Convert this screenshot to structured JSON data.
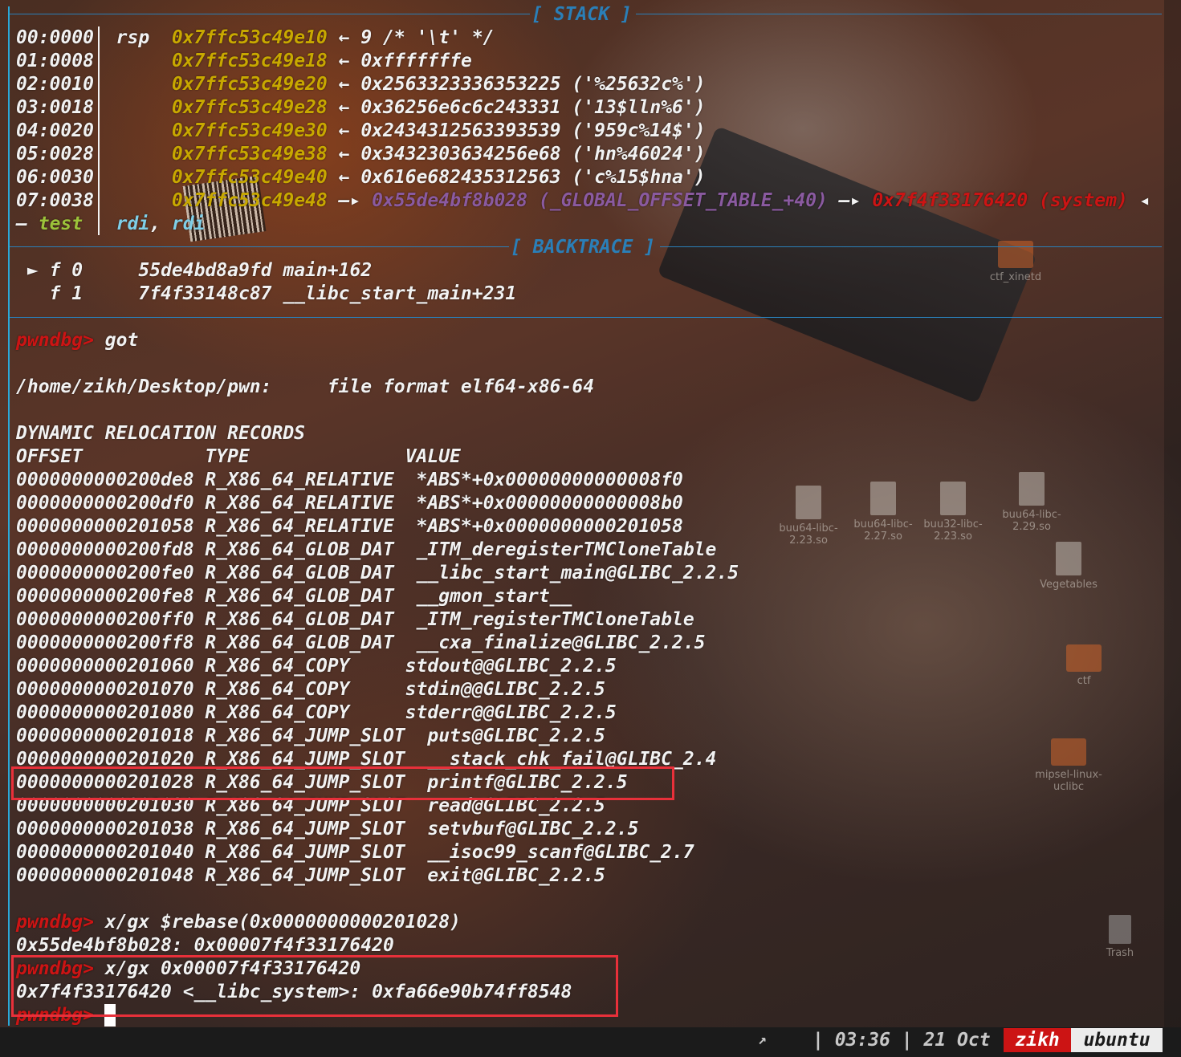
{
  "colors": {
    "address": "#c8a800",
    "got": "#8a5aa0",
    "libc": "#cc1414",
    "prompt": "#cc1414",
    "separator": "#2a7fb8",
    "highlight": "#e8303a"
  },
  "sections": {
    "stack": "[ STACK ]",
    "backtrace": "[ BACKTRACE ]"
  },
  "stack": [
    {
      "idx": "00:0000",
      "reg": "rsp",
      "addr": "0x7ffc53c49e10",
      "arrow": "←",
      "val": "9 /* '\\t' */"
    },
    {
      "idx": "01:0008",
      "reg": "",
      "addr": "0x7ffc53c49e18",
      "arrow": "←",
      "val": "0xfffffffe"
    },
    {
      "idx": "02:0010",
      "reg": "",
      "addr": "0x7ffc53c49e20",
      "arrow": "←",
      "val": "0x2563323336353225 ('%25632c%')"
    },
    {
      "idx": "03:0018",
      "reg": "",
      "addr": "0x7ffc53c49e28",
      "arrow": "←",
      "val": "0x36256e6c6c243331 ('13$lln%6')"
    },
    {
      "idx": "04:0020",
      "reg": "",
      "addr": "0x7ffc53c49e30",
      "arrow": "←",
      "val": "0x2434312563393539 ('959c%14$')"
    },
    {
      "idx": "05:0028",
      "reg": "",
      "addr": "0x7ffc53c49e38",
      "arrow": "←",
      "val": "0x3432303634256e68 ('hn%46024')"
    },
    {
      "idx": "06:0030",
      "reg": "",
      "addr": "0x7ffc53c49e40",
      "arrow": "←",
      "val": "0x616e682435312563 ('c%15$hna')"
    },
    {
      "idx": "07:0038",
      "reg": "",
      "addr": "0x7ffc53c49e48",
      "arrow": "—▸",
      "val": ""
    }
  ],
  "stack_last": {
    "got_entry": "0x55de4bf8b028 (_GLOBAL_OFFSET_TABLE_+40)",
    "arrow2": "—▸",
    "libc": "0x7f4f33176420 (system)",
    "tail": "◂"
  },
  "disasm_line": {
    "dash": "—",
    "op": "test",
    "args1": "rdi",
    "comma": ",",
    "args2": "rdi"
  },
  "backtrace": [
    {
      "marker": "►",
      "frame": "f 0",
      "addr": "55de4bd8a9fd",
      "sym": "main+162"
    },
    {
      "marker": "",
      "frame": "f 1",
      "addr": "7f4f33148c87",
      "sym": "__libc_start_main+231"
    }
  ],
  "prompt": "pwndbg>",
  "cmd1": "got",
  "file_line": "/home/zikh/Desktop/pwn:     file format elf64-x86-64",
  "reloc_title": "DYNAMIC RELOCATION RECORDS",
  "reloc_header": "OFFSET           TYPE              VALUE",
  "relocs": [
    "0000000000200de8 R_X86_64_RELATIVE  *ABS*+0x00000000000008f0",
    "0000000000200df0 R_X86_64_RELATIVE  *ABS*+0x00000000000008b0",
    "0000000000201058 R_X86_64_RELATIVE  *ABS*+0x0000000000201058",
    "0000000000200fd8 R_X86_64_GLOB_DAT  _ITM_deregisterTMCloneTable",
    "0000000000200fe0 R_X86_64_GLOB_DAT  __libc_start_main@GLIBC_2.2.5",
    "0000000000200fe8 R_X86_64_GLOB_DAT  __gmon_start__",
    "0000000000200ff0 R_X86_64_GLOB_DAT  _ITM_registerTMCloneTable",
    "0000000000200ff8 R_X86_64_GLOB_DAT  __cxa_finalize@GLIBC_2.2.5",
    "0000000000201060 R_X86_64_COPY     stdout@@GLIBC_2.2.5",
    "0000000000201070 R_X86_64_COPY     stdin@@GLIBC_2.2.5",
    "0000000000201080 R_X86_64_COPY     stderr@@GLIBC_2.2.5",
    "0000000000201018 R_X86_64_JUMP_SLOT  puts@GLIBC_2.2.5",
    "0000000000201020 R_X86_64_JUMP_SLOT  __stack_chk_fail@GLIBC_2.4",
    "0000000000201028 R_X86_64_JUMP_SLOT  printf@GLIBC_2.2.5",
    "0000000000201030 R_X86_64_JUMP_SLOT  read@GLIBC_2.2.5",
    "0000000000201038 R_X86_64_JUMP_SLOT  setvbuf@GLIBC_2.2.5",
    "0000000000201040 R_X86_64_JUMP_SLOT  __isoc99_scanf@GLIBC_2.7",
    "0000000000201048 R_X86_64_JUMP_SLOT  exit@GLIBC_2.2.5"
  ],
  "cmd2": "x/gx $rebase(0x0000000000201028)",
  "out2": "0x55de4bf8b028: 0x00007f4f33176420",
  "cmd3": "x/gx 0x00007f4f33176420",
  "out3": "0x7f4f33176420 <__libc_system>: 0xfa66e90b74ff8548",
  "statusbar": {
    "arrow": "↗",
    "time": "| 03:36 | 21 Oct",
    "user": "zikh",
    "host": "ubuntu"
  },
  "desktop_icons": [
    {
      "label": "ctf_xinetd",
      "kind": "folder-icon"
    },
    {
      "label": "buu64-libc-2.23.so",
      "kind": "file-icon"
    },
    {
      "label": "buu64-libc-2.27.so",
      "kind": "file-icon"
    },
    {
      "label": "buu32-libc-2.23.so",
      "kind": "file-icon"
    },
    {
      "label": "buu64-libc-2.29.so",
      "kind": "file-icon"
    },
    {
      "label": "Vegetables",
      "kind": "file-icon"
    },
    {
      "label": "ctf",
      "kind": "folder-icon"
    },
    {
      "label": "mipsel-linux-uclibc",
      "kind": "folder-icon"
    },
    {
      "label": "Trash",
      "kind": "trash-icon"
    }
  ]
}
